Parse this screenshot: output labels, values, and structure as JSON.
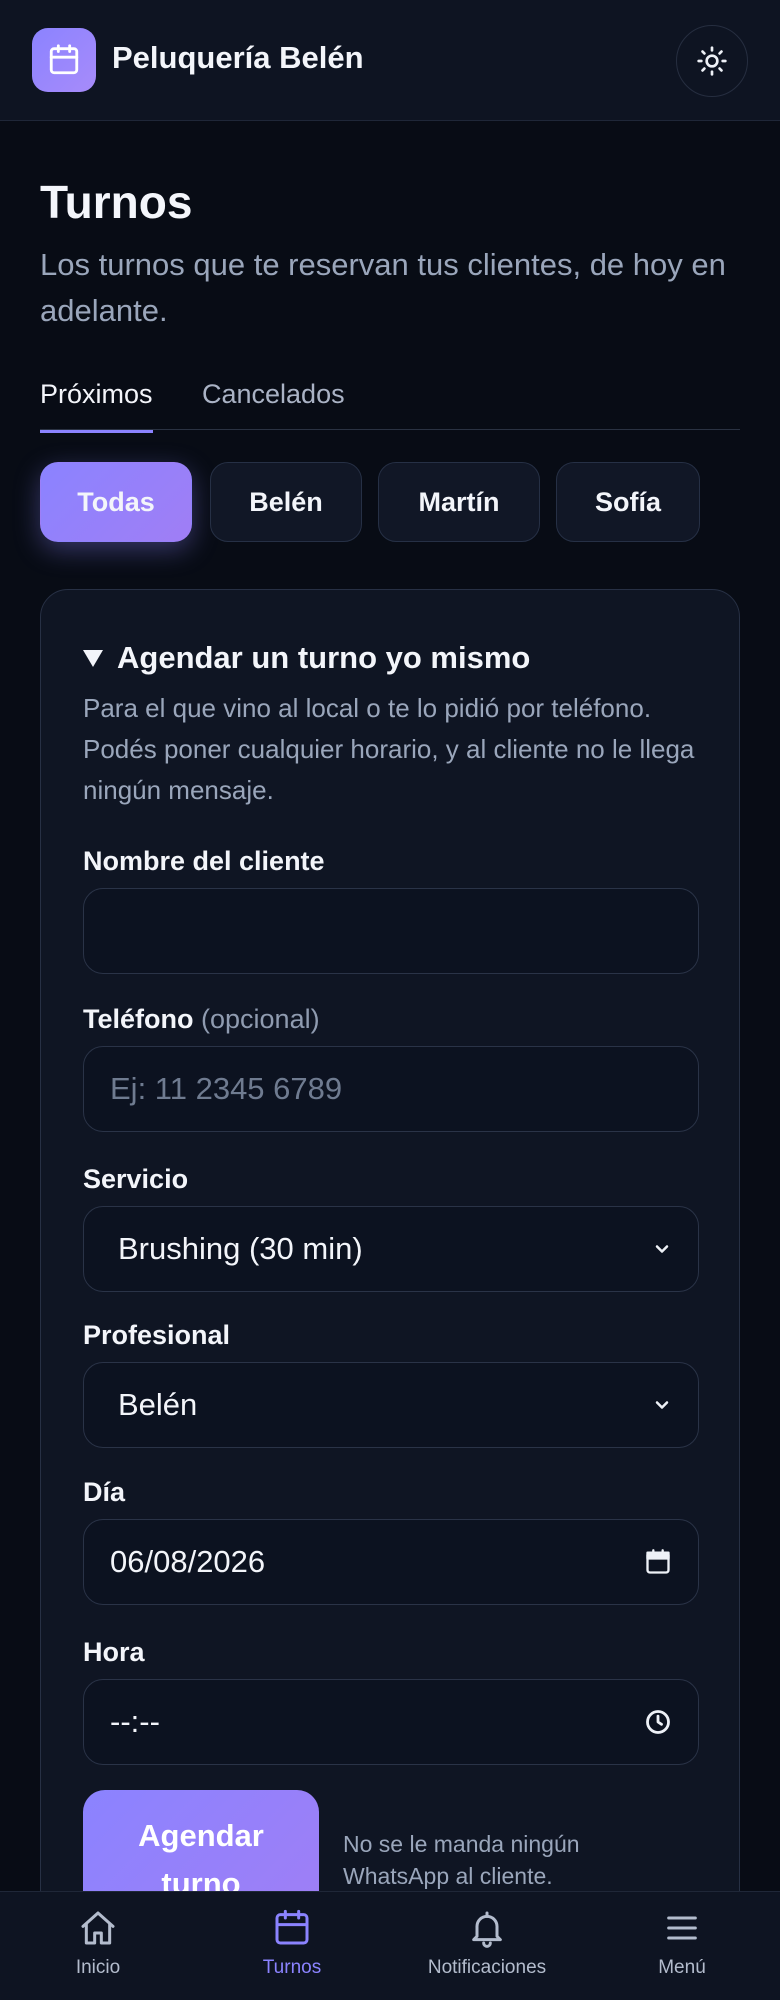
{
  "header": {
    "brand": "Peluquería Belén",
    "logo_icon": "calendar-icon",
    "theme_icon": "sun-icon"
  },
  "page": {
    "title": "Turnos",
    "subtitle": "Los turnos que te reservan tus clientes, de hoy en adelante."
  },
  "tabs": [
    {
      "label": "Próximos",
      "active": true
    },
    {
      "label": "Cancelados",
      "active": false
    }
  ],
  "filters": [
    {
      "label": "Todas",
      "active": true
    },
    {
      "label": "Belén",
      "active": false
    },
    {
      "label": "Martín",
      "active": false
    },
    {
      "label": "Sofía",
      "active": false
    }
  ],
  "form": {
    "summary": "Agendar un turno yo mismo",
    "description": "Para el que vino al local o te lo pidió por teléfono. Podés poner cualquier horario, y al cliente no le llega ningún mensaje.",
    "name": {
      "label": "Nombre del cliente",
      "value": ""
    },
    "phone": {
      "label": "Teléfono",
      "optional": "(opcional)",
      "placeholder": "Ej: 11 2345 6789"
    },
    "service": {
      "label": "Servicio",
      "value": "Brushing (30 min)"
    },
    "professional": {
      "label": "Profesional",
      "value": "Belén"
    },
    "day": {
      "label": "Día",
      "value": "06/08/2026"
    },
    "time": {
      "label": "Hora",
      "value": "--:--"
    },
    "submit_label_line1": "Agendar",
    "submit_label_line2": "turno",
    "submit_note": "No se le manda ningún WhatsApp al cliente."
  },
  "bottom_nav": [
    {
      "label": "Inicio",
      "icon": "home-icon",
      "active": false
    },
    {
      "label": "Turnos",
      "icon": "calendar-icon",
      "active": true
    },
    {
      "label": "Notificaciones",
      "icon": "bell-icon",
      "active": false
    },
    {
      "label": "Menú",
      "icon": "menu-icon",
      "active": false
    }
  ],
  "colors": {
    "accent": "#8b83ff",
    "background": "#080c15",
    "surface": "#0f1523"
  }
}
